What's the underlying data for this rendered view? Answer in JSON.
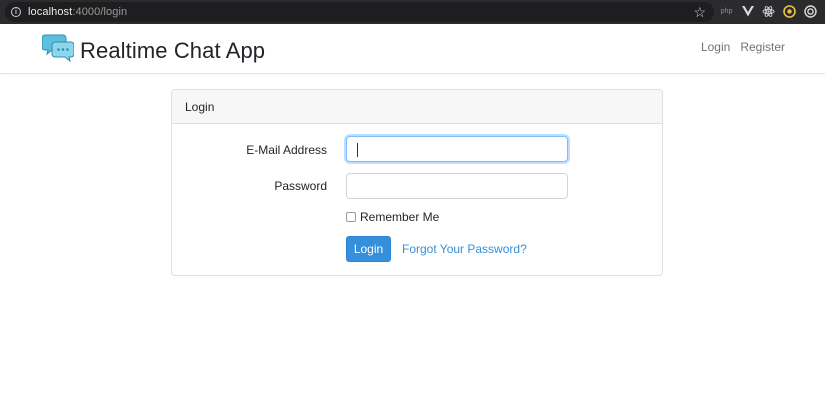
{
  "browser": {
    "url_host": "localhost",
    "url_path": ":4000/login"
  },
  "navbar": {
    "brand": "Realtime Chat App",
    "links": [
      {
        "label": "Login"
      },
      {
        "label": "Register"
      }
    ]
  },
  "login_card": {
    "header": "Login",
    "email_label": "E-Mail Address",
    "email_value": "",
    "password_label": "Password",
    "password_value": "",
    "remember_label": "Remember Me",
    "remember_checked": false,
    "submit_label": "Login",
    "forgot_label": "Forgot Your Password?"
  },
  "colors": {
    "primary": "#3490dc",
    "browser_bg": "#2b2b2e",
    "logo": "#5bc0de"
  },
  "icons": {
    "url_info": "info-icon",
    "bookmark": "star-icon",
    "brand_logo": "chat-bubbles-icon"
  }
}
